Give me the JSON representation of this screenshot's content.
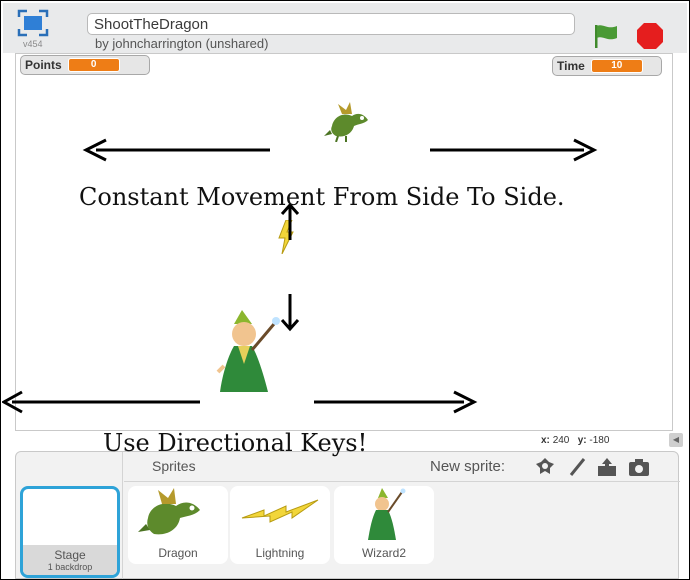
{
  "project": {
    "title": "ShootTheDragon",
    "author": "by johncharrington (unshared)",
    "version": "v454"
  },
  "monitors": {
    "points_label": "Points",
    "points_value": "0",
    "time_label": "Time",
    "time_value": "10"
  },
  "stage_annotations": {
    "top_caption": "Constant Movement From Side To Side.",
    "bottom_caption": "Use Directional Keys!"
  },
  "coordinates": {
    "x_label": "x:",
    "x_value": "240",
    "y_label": "y:",
    "y_value": "-180"
  },
  "sprite_pane": {
    "sprites_label": "Sprites",
    "new_sprite_label": "New sprite:",
    "stage": {
      "label": "Stage",
      "sublabel": "1 backdrop"
    },
    "sprites": [
      {
        "label": "Dragon"
      },
      {
        "label": "Lightning"
      },
      {
        "label": "Wizard2"
      }
    ]
  },
  "colors": {
    "monitor_value": "#ee7d16",
    "flag": "#3f8a2b",
    "stop": "#e51e1e",
    "selected_border": "#2ea3d8"
  },
  "icons": [
    "fullscreen-icon",
    "green-flag-icon",
    "stop-icon",
    "paint-sprite-icon",
    "brush-icon",
    "upload-icon",
    "camera-icon"
  ]
}
